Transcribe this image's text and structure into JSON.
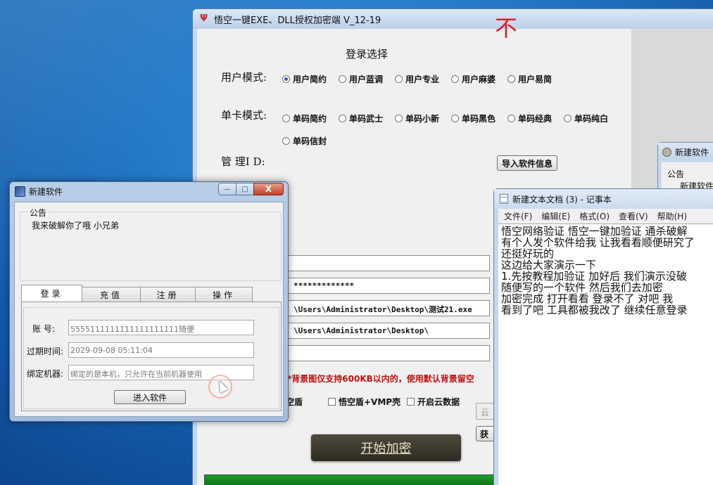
{
  "main_window": {
    "title": "悟空一键EXE、DLL授权加密端 V_12-19",
    "red_corner_text": "不",
    "section_title": "登录选择",
    "user_mode_label": "用户模式:",
    "user_mode_options": [
      "用户简约",
      "用户蓝调",
      "用户专业",
      "用户麻婆",
      "用户易简"
    ],
    "user_mode_selected": "用户简约",
    "card_mode_label": "单卡模式:",
    "card_mode_options": [
      "单码简约",
      "单码武士",
      "单码小新",
      "单码黑色",
      "单码经典",
      "单码纯白",
      "单码信封"
    ],
    "admin_id_label": "管 理I D:",
    "import_button": "导入软件信息",
    "password_field": "*************",
    "exe_path": "\\Users\\Administrator\\Desktop\\测试21.exe",
    "output_dir": "\\Users\\Administrator\\Desktop\\",
    "bg_note": "*背景图仅支持600KB以内的，使用默认背景留空",
    "checkboxes": [
      "悟空盾",
      "悟空盾+VMP壳",
      "开启云数据"
    ],
    "cloud_button": "云数",
    "get_button": "获",
    "start_button": "开始加密"
  },
  "partial_window": {
    "title": "新建软件",
    "group_label": "公告",
    "body_text": "新建软件"
  },
  "notepad": {
    "title": "新建文本文档 (3) - 记事本",
    "menu": [
      "文件(F)",
      "编辑(E)",
      "格式(O)",
      "查看(V)",
      "帮助(H)"
    ],
    "lines": [
      "悟空网络验证  悟空一键加验证 通杀破解",
      "有个人发个软件给我 让我看看顺便研究了",
      "还挺好玩的",
      "这边给大家演示一下",
      "1.先按教程加验证  加好后 我们演示没破",
      "随便写的一个软件 然后我们去加密",
      "加密完成 打开看看   登录不了   对吧 我",
      "看到了吧 工具都被我改了    继续任意登录"
    ]
  },
  "login_window": {
    "title": "新建软件",
    "notice_label": "公告",
    "notice_text": "我来破解你了哦  小兄弟",
    "tabs": [
      "登录",
      "充值",
      "注册",
      "操作"
    ],
    "active_tab": "登录",
    "account_label": "账  号:",
    "account_value": "5555111111111111111111随便",
    "expiry_label": "过期时间:",
    "expiry_value": "2029-09-08 05:11:04",
    "machine_label": "绑定机器:",
    "machine_value": "绑定的是本机，只允许在当前机器使用",
    "enter_button": "进入软件",
    "window_controls": [
      "—",
      "□",
      "X"
    ]
  }
}
